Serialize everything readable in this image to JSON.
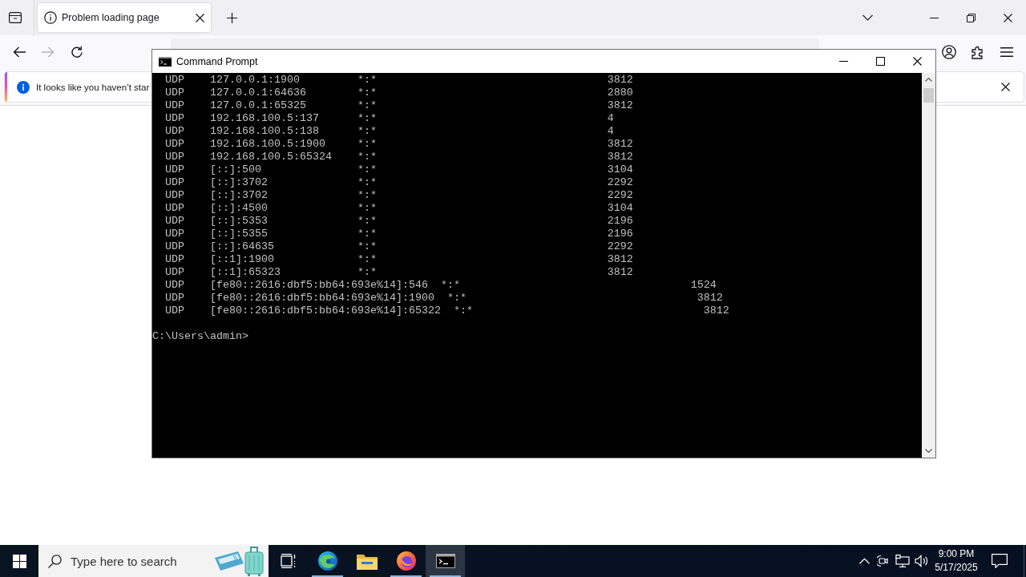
{
  "browser": {
    "tabs": [
      {
        "title": "Problem loading page",
        "selected": true
      }
    ],
    "nav_buttons": [
      {
        "kind": "back",
        "disabled": false
      },
      {
        "kind": "forward",
        "disabled": true
      },
      {
        "kind": "reload",
        "disabled": false
      }
    ],
    "notification": {
      "text": "It looks like you haven’t star"
    }
  },
  "cmd_window": {
    "title": "Command Prompt",
    "rows": [
      {
        "protocol": "UDP",
        "local": "127.0.0.1:1900",
        "foreign": "*:*",
        "pid": "3812"
      },
      {
        "protocol": "UDP",
        "local": "127.0.0.1:64636",
        "foreign": "*:*",
        "pid": "2880"
      },
      {
        "protocol": "UDP",
        "local": "127.0.0.1:65325",
        "foreign": "*:*",
        "pid": "3812"
      },
      {
        "protocol": "UDP",
        "local": "192.168.100.5:137",
        "foreign": "*:*",
        "pid": "4"
      },
      {
        "protocol": "UDP",
        "local": "192.168.100.5:138",
        "foreign": "*:*",
        "pid": "4"
      },
      {
        "protocol": "UDP",
        "local": "192.168.100.5:1900",
        "foreign": "*:*",
        "pid": "3812"
      },
      {
        "protocol": "UDP",
        "local": "192.168.100.5:65324",
        "foreign": "*:*",
        "pid": "3812"
      },
      {
        "protocol": "UDP",
        "local": "[::]:500",
        "foreign": "*:*",
        "pid": "3104"
      },
      {
        "protocol": "UDP",
        "local": "[::]:3702",
        "foreign": "*:*",
        "pid": "2292"
      },
      {
        "protocol": "UDP",
        "local": "[::]:3702",
        "foreign": "*:*",
        "pid": "2292"
      },
      {
        "protocol": "UDP",
        "local": "[::]:4500",
        "foreign": "*:*",
        "pid": "3104"
      },
      {
        "protocol": "UDP",
        "local": "[::]:5353",
        "foreign": "*:*",
        "pid": "2196"
      },
      {
        "protocol": "UDP",
        "local": "[::]:5355",
        "foreign": "*:*",
        "pid": "2196"
      },
      {
        "protocol": "UDP",
        "local": "[::]:64635",
        "foreign": "*:*",
        "pid": "2292"
      },
      {
        "protocol": "UDP",
        "local": "[::1]:1900",
        "foreign": "*:*",
        "pid": "3812"
      },
      {
        "protocol": "UDP",
        "local": "[::1]:65323",
        "foreign": "*:*",
        "pid": "3812"
      },
      {
        "protocol": "UDP",
        "local": "[fe80::2616:dbf5:bb64:693e%14]:546",
        "foreign": "*:*",
        "pid": "1524"
      },
      {
        "protocol": "UDP",
        "local": "[fe80::2616:dbf5:bb64:693e%14]:1900",
        "foreign": "*:*",
        "pid": "3812"
      },
      {
        "protocol": "UDP",
        "local": "[fe80::2616:dbf5:bb64:693e%14]:65322",
        "foreign": "*:*",
        "pid": "3812"
      }
    ],
    "prompt": "C:\\Users\\admin>"
  },
  "taskbar": {
    "search": {
      "placeholder": "Type here to search"
    },
    "apps": [
      {
        "kind": "task_view",
        "running": false,
        "selected": false
      },
      {
        "kind": "edge",
        "running": true,
        "selected": false
      },
      {
        "kind": "explorer",
        "running": false,
        "selected": false
      },
      {
        "kind": "firefox",
        "running": true,
        "selected": false
      },
      {
        "kind": "terminal",
        "running": true,
        "selected": true
      }
    ],
    "clock": {
      "time": "9:00 PM",
      "date": "5/17/2025"
    }
  }
}
